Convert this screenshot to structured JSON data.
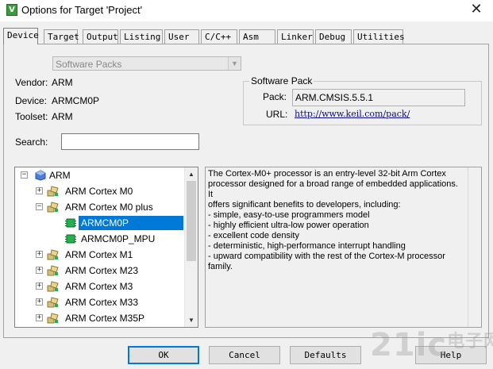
{
  "window": {
    "title": "Options for Target 'Project'",
    "icon_letter": "V",
    "close_glyph": "✕"
  },
  "tabs": [
    {
      "label": "Device",
      "active": true
    },
    {
      "label": "Target",
      "active": false
    },
    {
      "label": "Output",
      "active": false
    },
    {
      "label": "Listing",
      "active": false
    },
    {
      "label": "User",
      "active": false
    },
    {
      "label": "C/C++",
      "active": false
    },
    {
      "label": "Asm",
      "active": false
    },
    {
      "label": "Linker",
      "active": false
    },
    {
      "label": "Debug",
      "active": false
    },
    {
      "label": "Utilities",
      "active": false
    }
  ],
  "device_db": {
    "selected": "Software Packs",
    "enabled": false
  },
  "info": {
    "vendor_label": "Vendor:",
    "vendor": "ARM",
    "device_label": "Device:",
    "device": "ARMCM0P",
    "toolset_label": "Toolset:",
    "toolset": "ARM",
    "search_label": "Search:",
    "search_value": ""
  },
  "software_pack": {
    "group_title": "Software Pack",
    "pack_label": "Pack:",
    "pack_value": "ARM.CMSIS.5.5.1",
    "url_label": "URL:",
    "url_value": "http://www.keil.com/pack/"
  },
  "tree": {
    "items": [
      {
        "label": "ARM",
        "level": 0,
        "expander": "−",
        "icon": "vendor-icon"
      },
      {
        "label": "ARM Cortex M0",
        "level": 1,
        "expander": "+",
        "icon": "device-family-icon"
      },
      {
        "label": "ARM Cortex M0 plus",
        "level": 1,
        "expander": "−",
        "icon": "device-family-icon"
      },
      {
        "label": "ARMCM0P",
        "level": 2,
        "expander": "",
        "icon": "chip-icon",
        "selected": true
      },
      {
        "label": "ARMCM0P_MPU",
        "level": 2,
        "expander": "",
        "icon": "chip-icon"
      },
      {
        "label": "ARM Cortex M1",
        "level": 1,
        "expander": "+",
        "icon": "device-family-icon"
      },
      {
        "label": "ARM Cortex M23",
        "level": 1,
        "expander": "+",
        "icon": "device-family-icon"
      },
      {
        "label": "ARM Cortex M3",
        "level": 1,
        "expander": "+",
        "icon": "device-family-icon"
      },
      {
        "label": "ARM Cortex M33",
        "level": 1,
        "expander": "+",
        "icon": "device-family-icon"
      },
      {
        "label": "ARM Cortex M35P",
        "level": 1,
        "expander": "+",
        "icon": "device-family-icon"
      },
      {
        "label": "",
        "level": 1,
        "expander": "+",
        "icon": "device-family-icon"
      }
    ],
    "scroll_up": "▲",
    "scroll_down": "▼"
  },
  "description": "The Cortex-M0+ processor is an entry-level 32-bit Arm Cortex\nprocessor designed for a broad range of embedded applications. It\noffers significant benefits to developers, including:\n- simple, easy-to-use programmers model\n- highly efficient ultra-low power operation\n- excellent code density\n- deterministic, high-performance interrupt handling\n- upward compatibility with the rest of the Cortex-M processor family.",
  "buttons": {
    "ok": "OK",
    "cancel": "Cancel",
    "defaults": "Defaults",
    "help": "Help"
  },
  "watermark": {
    "text": "21ic",
    "sub": "电子网"
  },
  "colors": {
    "selection": "#0078d7",
    "url": "#0a0a8a",
    "chip_green": "#22b14c"
  }
}
